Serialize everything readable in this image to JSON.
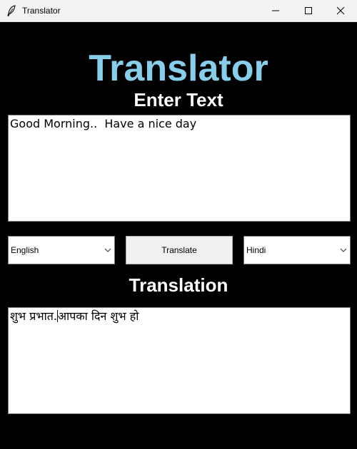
{
  "window": {
    "title": "Translator",
    "icon": "feather-icon"
  },
  "controls": {
    "minimize_icon": "minimize-icon",
    "maximize_icon": "maximize-icon",
    "close_icon": "close-icon"
  },
  "header": {
    "title": "Translator",
    "title_color": "#87ceeb",
    "enter_label": "Enter Text"
  },
  "input": {
    "value": "Good Morning..  Have a nice day"
  },
  "languages": {
    "source": "English",
    "target": "Hindi",
    "dropdown_icon": "chevron-down-icon"
  },
  "actions": {
    "translate_label": "Translate"
  },
  "output": {
    "label": "Translation",
    "value_before_caret": "शुभ प्रभात.",
    "value_after_caret": "आपका दिन शुभ हो"
  },
  "colors": {
    "background": "#000000",
    "heading": "#87ceeb",
    "label": "#ffffff"
  }
}
